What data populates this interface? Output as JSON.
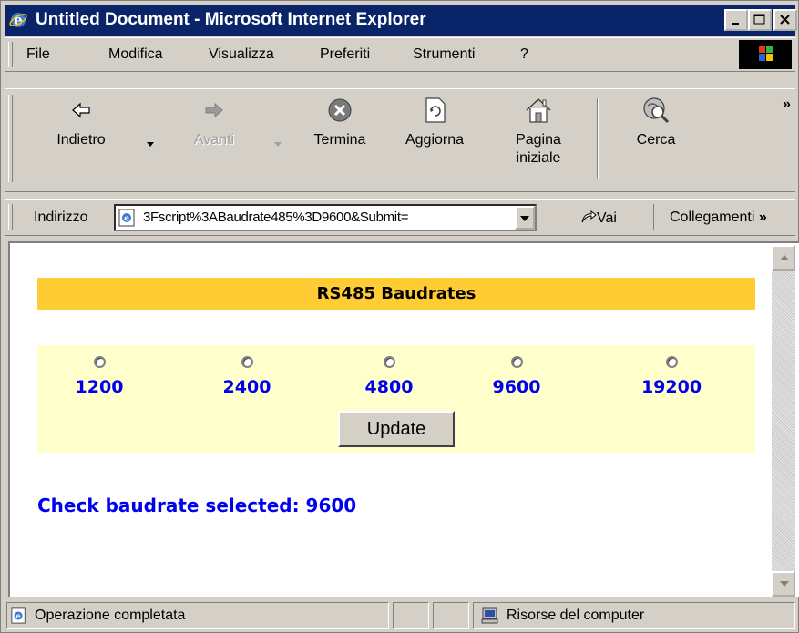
{
  "window": {
    "title": "Untitled Document - Microsoft Internet Explorer"
  },
  "menu": [
    "File",
    "Modifica",
    "Visualizza",
    "Preferiti",
    "Strumenti",
    "?"
  ],
  "toolbar": {
    "back": "Indietro",
    "forward": "Avanti",
    "stop": "Termina",
    "refresh": "Aggiorna",
    "home_line1": "Pagina",
    "home_line2": "iniziale",
    "search": "Cerca",
    "more": "»"
  },
  "address": {
    "label": "Indirizzo",
    "url": "3Fscript%3ABaudrate485%3D9600&Submit=",
    "go": "Vai",
    "links": "Collegamenti"
  },
  "page": {
    "heading": "RS485 Baudrates",
    "baudrates": [
      {
        "label": "1200",
        "selected": false
      },
      {
        "label": "2400",
        "selected": false
      },
      {
        "label": "4800",
        "selected": false
      },
      {
        "label": "9600",
        "selected": false
      },
      {
        "label": "19200",
        "selected": false
      }
    ],
    "update_button": "Update",
    "check_text": "Check baudrate selected: 9600"
  },
  "status": {
    "message": "Operazione completata",
    "zone": "Risorse del computer"
  },
  "colors": {
    "titlebar": "#0a246a",
    "heading_bg": "#ffcc33",
    "panel_bg": "#ffffcc",
    "link_blue": "#0000ee"
  }
}
